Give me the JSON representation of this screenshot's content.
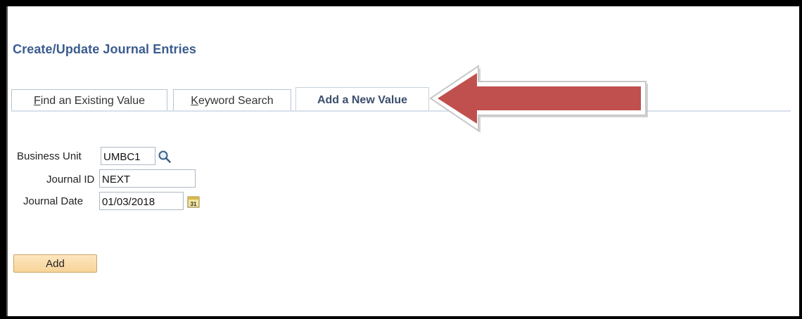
{
  "page": {
    "title": "Create/Update Journal Entries"
  },
  "tabs": [
    {
      "label_first": "F",
      "label_rest": "ind an Existing Value",
      "active": false
    },
    {
      "label_first": "K",
      "label_rest": "eyword Search",
      "active": false
    },
    {
      "label": "Add a New Value",
      "active": true
    }
  ],
  "form": {
    "business_unit": {
      "label": "Business Unit",
      "value": "UMBC1"
    },
    "journal_id": {
      "label": "Journal ID",
      "value": "NEXT"
    },
    "journal_date": {
      "label": "Journal Date",
      "value": "01/03/2018"
    }
  },
  "actions": {
    "add_label": "Add"
  },
  "icons": {
    "lookup": "magnifier-lookup-icon",
    "calendar": "calendar-icon",
    "calendar_day": "31",
    "annotation": "red-arrow-pointer"
  },
  "colors": {
    "title": "#3b5c8f",
    "arrow": "#c0504d",
    "button": "#f7d49a"
  }
}
